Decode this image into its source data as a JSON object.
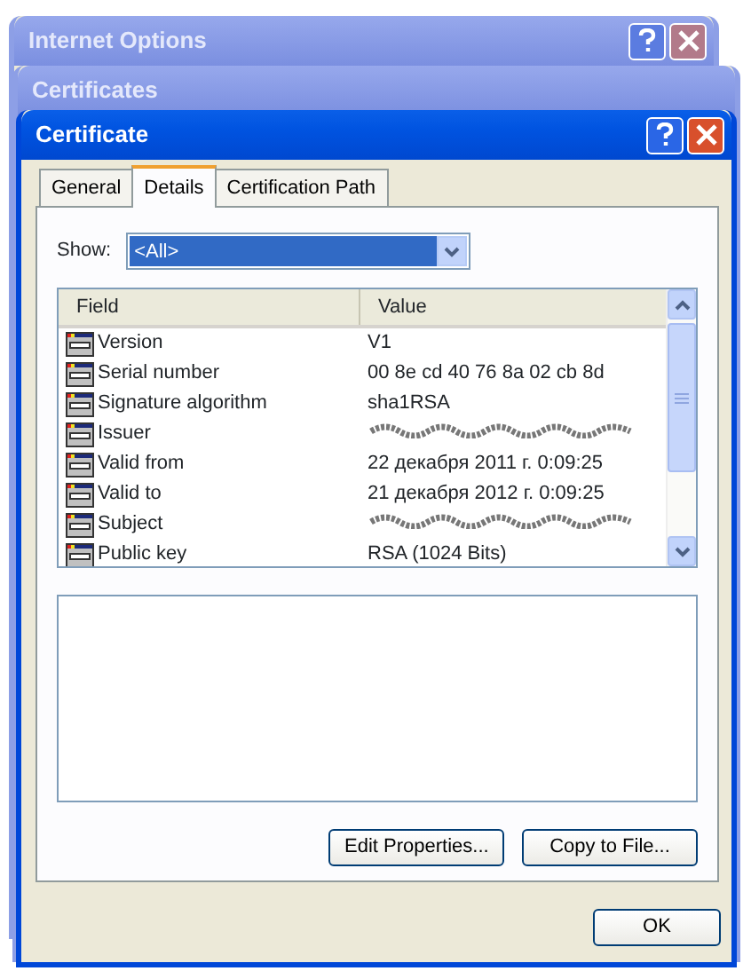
{
  "background_windows": [
    {
      "title": "Internet Options"
    },
    {
      "title": "Certificates"
    }
  ],
  "window": {
    "title": "Certificate"
  },
  "tabs": [
    {
      "label": "General",
      "selected": false
    },
    {
      "label": "Details",
      "selected": true
    },
    {
      "label": "Certification Path",
      "selected": false
    }
  ],
  "show": {
    "label": "Show:",
    "value": "<All>"
  },
  "table": {
    "columns": [
      "Field",
      "Value"
    ],
    "rows": [
      {
        "field": "Version",
        "value": "V1",
        "redacted": false
      },
      {
        "field": "Serial number",
        "value": "00 8e cd 40 76 8a 02 cb 8d",
        "redacted": false
      },
      {
        "field": "Signature algorithm",
        "value": "sha1RSA",
        "redacted": false
      },
      {
        "field": "Issuer",
        "value": "",
        "redacted": true
      },
      {
        "field": "Valid from",
        "value": "22 декабря 2011 г. 0:09:25",
        "redacted": false
      },
      {
        "field": "Valid to",
        "value": "21 декабря 2012 г. 0:09:25",
        "redacted": false
      },
      {
        "field": "Subject",
        "value": "",
        "redacted": true
      },
      {
        "field": "Public key",
        "value": "RSA (1024 Bits)",
        "redacted": false
      }
    ]
  },
  "buttons": [
    "Edit Properties...",
    "Copy to File..."
  ],
  "footer_buttons": [
    "OK"
  ]
}
